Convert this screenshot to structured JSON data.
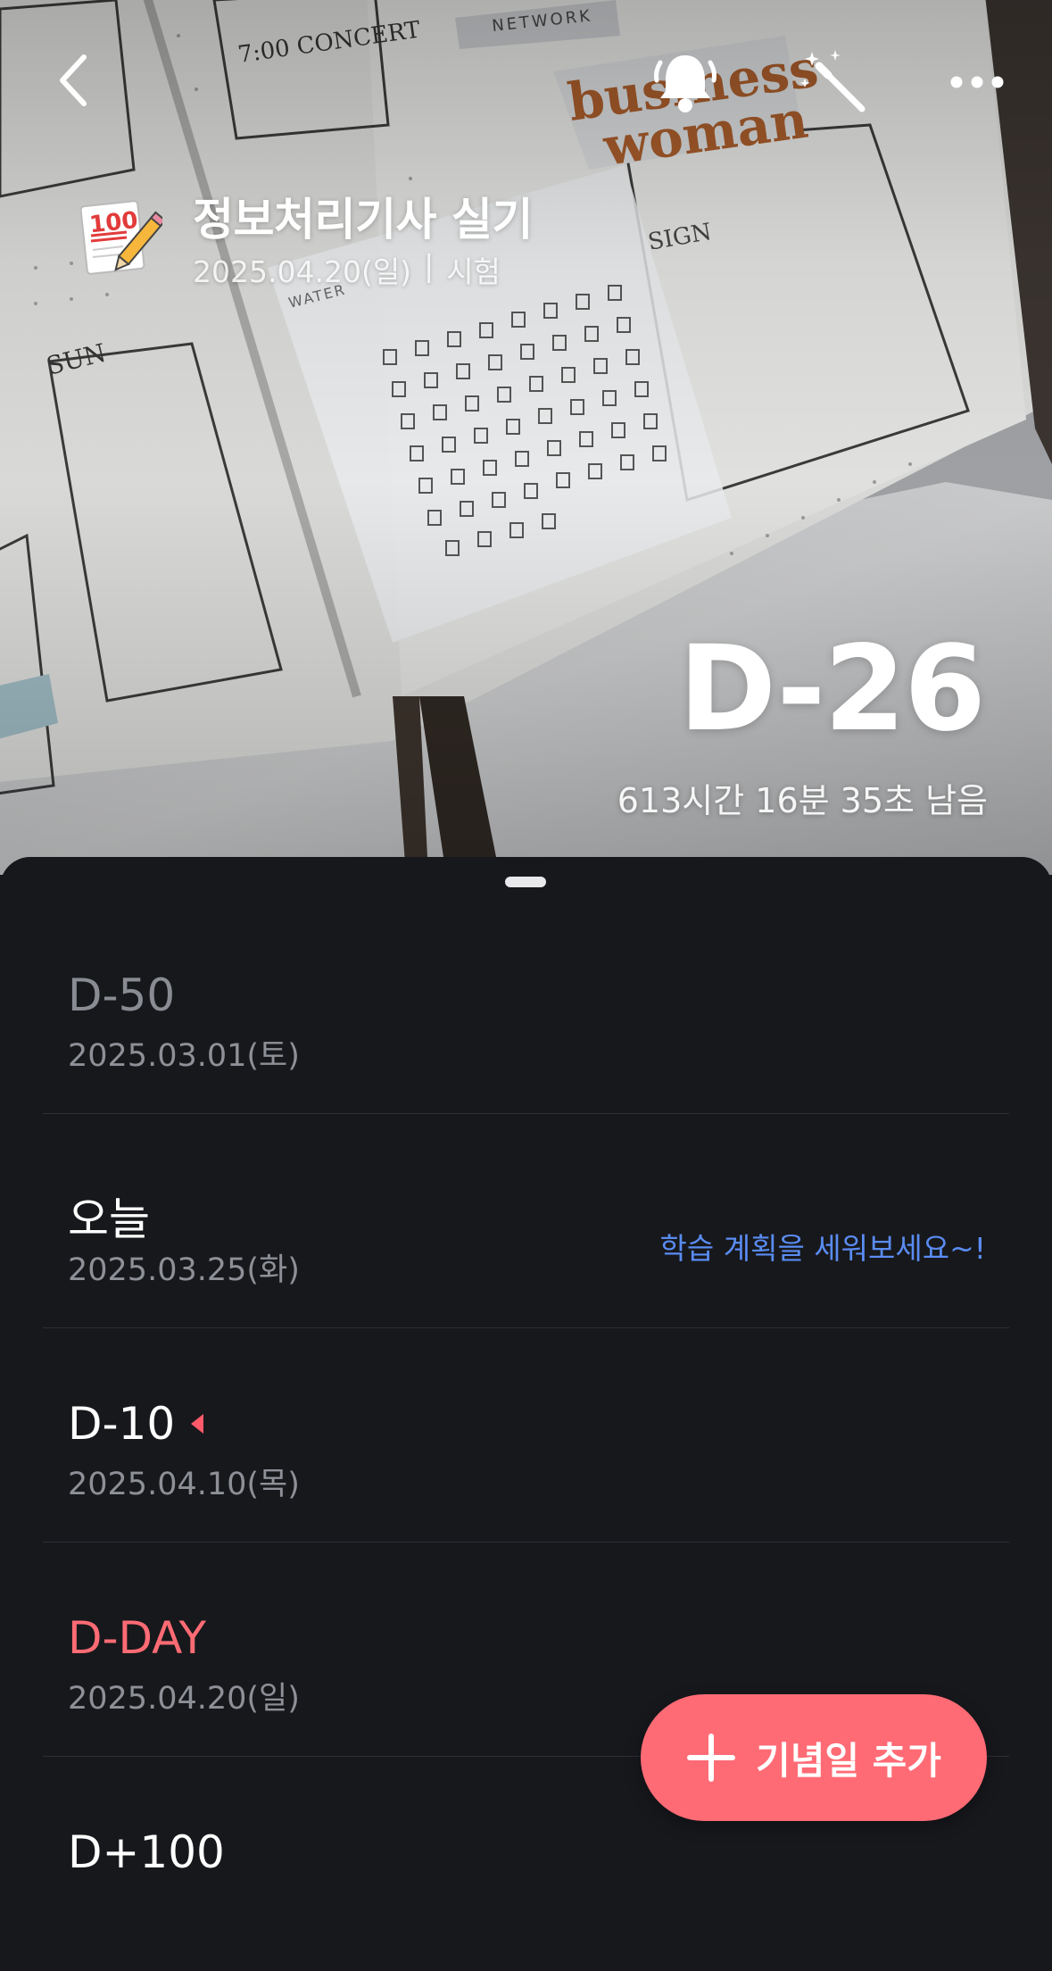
{
  "header": {
    "back_icon": "chevron-left-icon",
    "alarm_icon": "bell-icon",
    "magic_icon": "magic-wand-icon",
    "more_icon": "more-horizontal-icon"
  },
  "event": {
    "icon": "100-points-memo-icon",
    "icon_text": "100",
    "title": "정보처리기사 실기",
    "date": "2025.04.20(일)",
    "separator": "|",
    "category": "시험",
    "dday": "D-26",
    "remaining": "613시간 16분 35초 남음"
  },
  "background_text": {
    "sticker_line1": "business",
    "sticker_line2": "woman",
    "concert": "7:00 CONCERT",
    "network": "NETWORK",
    "sun": "SUN",
    "water": "WATER",
    "sign": "SIGN"
  },
  "milestones": [
    {
      "label": "D-50",
      "date": "2025.03.01(토)",
      "state": "past"
    },
    {
      "label": "오늘",
      "date": "2025.03.25(화)",
      "state": "today",
      "hint": "학습 계획을 세워보세요~!"
    },
    {
      "label": "D-10",
      "date": "2025.04.10(목)",
      "state": "upcoming",
      "marker": "current-position-marker"
    },
    {
      "label": "D-DAY",
      "date": "2025.04.20(일)",
      "state": "dday"
    },
    {
      "label": "D+100",
      "date": "",
      "state": "future"
    }
  ],
  "fab": {
    "label": "기념일 추가",
    "icon": "plus-icon"
  },
  "colors": {
    "accent": "#ff6b75",
    "dday_text": "#ff6b74",
    "hint_text": "#5a8cf2",
    "sheet_bg": "#17181c"
  }
}
